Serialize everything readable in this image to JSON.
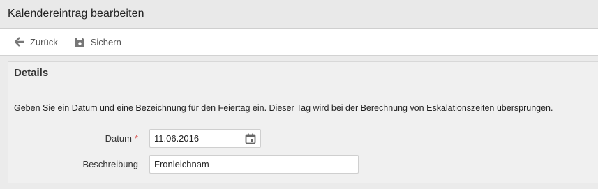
{
  "window": {
    "title": "Kalendereintrag bearbeiten"
  },
  "toolbar": {
    "back": {
      "label": "Zurück",
      "icon": "arrow-left-icon"
    },
    "save": {
      "label": "Sichern",
      "icon": "floppy-disk-icon"
    }
  },
  "details": {
    "title": "Details",
    "description": "Geben Sie ein Datum und eine Bezeichnung für den Feiertag ein. Dieser Tag wird bei der Berechnung von Eskalationszeiten übersprungen.",
    "date": {
      "label": "Datum",
      "required_marker": "*",
      "value": "11.06.2016",
      "icon": "calendar-icon"
    },
    "description_field": {
      "label": "Beschreibung",
      "value": "Fronleichnam"
    }
  },
  "colors": {
    "required": "#d9534f",
    "toolbar_icon": "#666666"
  }
}
